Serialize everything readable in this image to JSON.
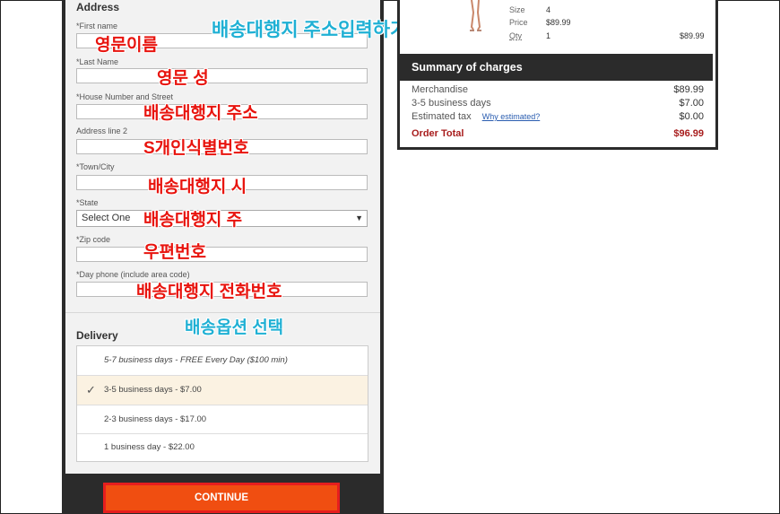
{
  "address": {
    "title": "Address",
    "fields": [
      {
        "label": "*First name"
      },
      {
        "label": "*Last Name"
      },
      {
        "label": "*House Number and Street"
      },
      {
        "label": "Address line 2"
      },
      {
        "label": "*Town/City"
      },
      {
        "label": "*State",
        "value": "Select One"
      },
      {
        "label": "*Zip code"
      },
      {
        "label": "*Day phone (include area code)"
      }
    ]
  },
  "delivery": {
    "title": "Delivery",
    "options": [
      {
        "label": "5-7 business days - FREE Every Day ($100 min)"
      },
      {
        "label": "3-5 business days - $7.00",
        "selected": true
      },
      {
        "label": "2-3 business days - $17.00"
      },
      {
        "label": "1 business day - $22.00"
      }
    ]
  },
  "continue_label": "CONTINUE",
  "overlays": {
    "header": "배송대행지 주소입력하기",
    "first_name": "영문이름",
    "last_name": "영문 성",
    "street": "배송대행지 주소",
    "line2": "S개인식별번호",
    "city": "배송대행지 시",
    "state": "배송대행지 주",
    "zip": "우편번호",
    "phone": "배송대행지 전화번호",
    "delivery": "배송옵션 선택"
  },
  "product": {
    "size_label": "Size",
    "size": "4",
    "price_label": "Price",
    "price": "$89.99",
    "qty_label": "Qty",
    "qty": "1",
    "line_total": "$89.99"
  },
  "summary": {
    "title": "Summary of charges",
    "merchandise_label": "Merchandise",
    "merchandise": "$89.99",
    "shipping_label": "3-5 business days",
    "shipping": "$7.00",
    "tax_label": "Estimated tax",
    "tax_link": "Why estimated?",
    "tax": "$0.00",
    "total_label": "Order Total",
    "total": "$96.99"
  },
  "colors": {
    "accent": "#f04e11",
    "dark": "#2b2b2b",
    "total": "#a81d1d",
    "overlay_red": "#e8140e",
    "overlay_blue": "#1fb0d4"
  }
}
